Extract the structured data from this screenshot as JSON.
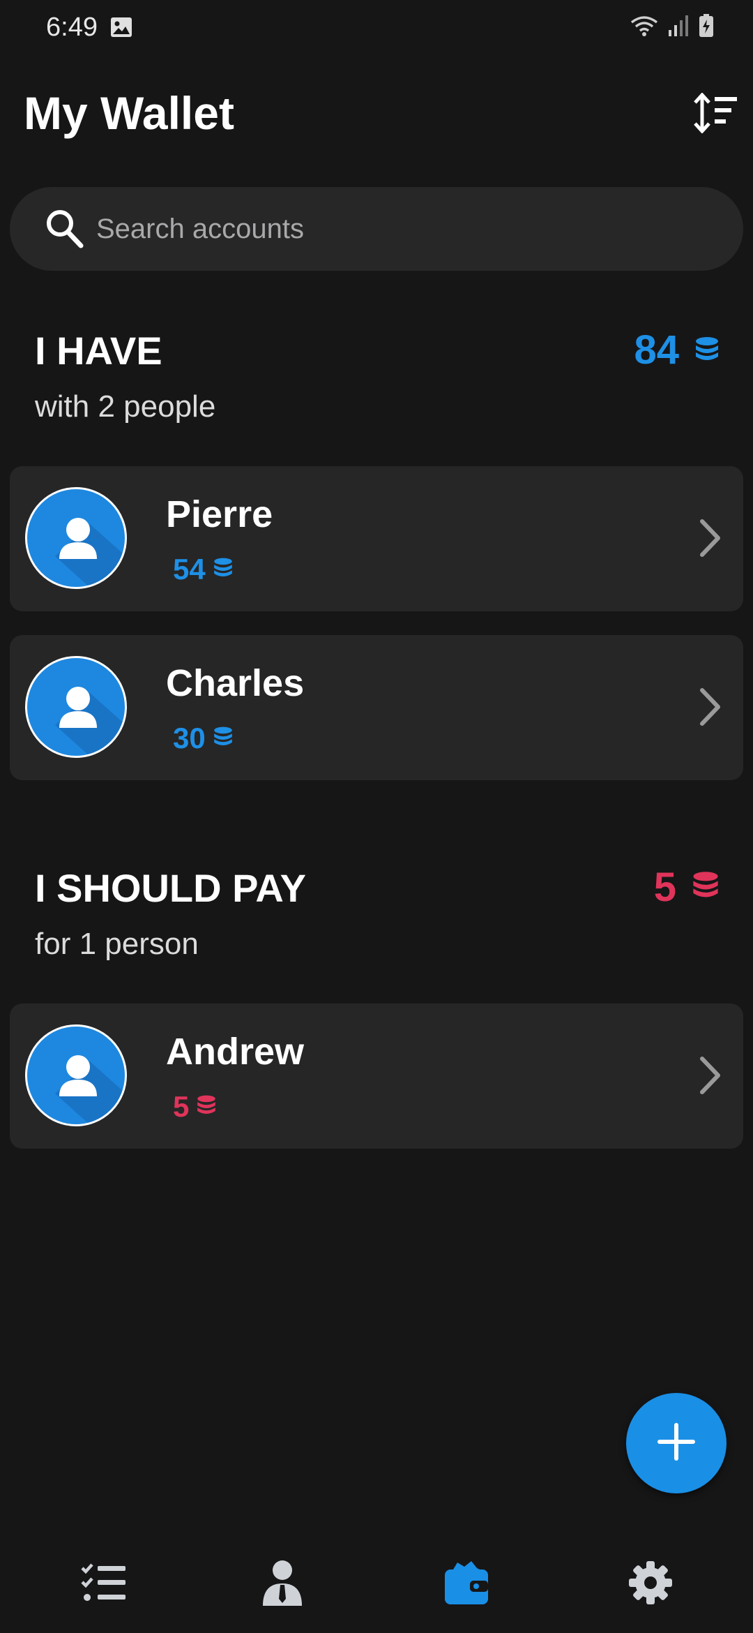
{
  "status_bar": {
    "time": "6:49"
  },
  "header": {
    "title": "My Wallet"
  },
  "search": {
    "placeholder": "Search accounts",
    "value": ""
  },
  "sections": [
    {
      "title": "I HAVE",
      "subtitle": "with 2 people",
      "total": "84",
      "color": "#1e90e6",
      "accounts": [
        {
          "name": "Pierre",
          "amount": "54"
        },
        {
          "name": "Charles",
          "amount": "30"
        }
      ]
    },
    {
      "title": "I SHOULD PAY",
      "subtitle": "for 1 person",
      "total": "5",
      "color": "#e0345a",
      "accounts": [
        {
          "name": "Andrew",
          "amount": "5"
        }
      ]
    }
  ],
  "bottom_nav": {
    "items": [
      {
        "icon": "checklist-icon",
        "active": false
      },
      {
        "icon": "person-icon",
        "active": false
      },
      {
        "icon": "wallet-icon",
        "active": true
      },
      {
        "icon": "gear-icon",
        "active": false
      }
    ]
  },
  "colors": {
    "accent": "#1a8fe6",
    "debt": "#e0345a",
    "background": "#161617",
    "card": "#262627"
  }
}
